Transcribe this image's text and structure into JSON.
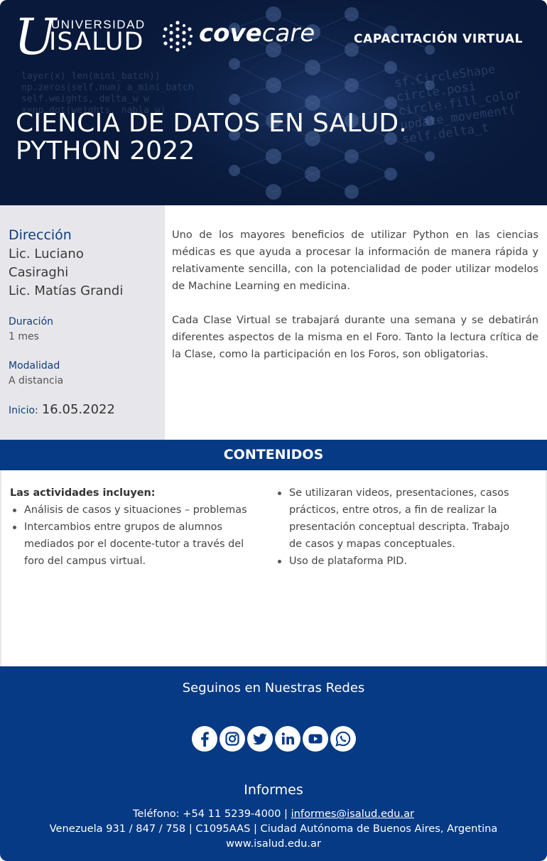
{
  "header": {
    "logo_univ_letter": "U",
    "logo_universidad": "UNIVERSIDAD",
    "logo_isalud": "ISALUD",
    "logo_cove_bold": "cove",
    "logo_cove_light": "care",
    "capacitacion": "CAPACITACIÓN VIRTUAL",
    "title_line1": "CIENCIA DE DATOS EN SALUD.",
    "title_line2": "PYTHON 2022"
  },
  "sidebar": {
    "direccion_label": "Dirección",
    "director_1a": "Lic. Luciano",
    "director_1b": "Casiraghi",
    "director_2": "Lic. Matías Grandi",
    "duracion_label": "Duración",
    "duracion_value": "1 mes",
    "modalidad_label": "Modalidad",
    "modalidad_value": "A distancia",
    "inicio_label": "Inicio:",
    "inicio_value": "16.05.2022"
  },
  "description": {
    "paragraph_1": "Uno de los mayores beneficios de utilizar Python en las ciencias médicas es que ayuda a procesar la información de manera rápida y relativamente sencilla, con la potencialidad de poder utilizar modelos de Machine Learning en medicina.",
    "paragraph_2": "Cada Clase Virtual se trabajará durante una semana y se debatirán diferentes aspectos de la misma en el Foro. Tanto la lectura crítica de la Clase, como la participación en los Foros, son obligatorias."
  },
  "contenidos": {
    "title": "CONTENIDOS",
    "heading": "Las actividades incluyen:",
    "left_items": [
      "Análisis de casos y situaciones – problemas",
      "Intercambios entre grupos de alumnos mediados por el docente-tutor a través del foro del campus virtual."
    ],
    "right_items": [
      "Se utilizaran videos, presentaciones, casos prácticos, entre otros, a fin de realizar la presentación conceptual descripta. Trabajo de casos y mapas conceptuales.",
      "Uso de plataforma PID."
    ]
  },
  "footer": {
    "seguinos": "Seguinos en Nuestras Redes",
    "socials": [
      "facebook-icon",
      "instagram-icon",
      "twitter-icon",
      "linkedin-icon",
      "youtube-icon",
      "whatsapp-icon"
    ],
    "informes_title": "Informes",
    "telefono_prefix": "Teléfono: +54 11 5239-4000 | ",
    "email": "informes@isalud.edu.ar",
    "address": "Venezuela 931 / 847 / 758 | C1095AAS | Ciudad Autónoma de Buenos Aires, Argentina",
    "website": "www.isalud.edu.ar"
  },
  "colors": {
    "brand_blue": "#063a85",
    "heading_blue": "#0e3d7e",
    "sidebar_grey": "#e7e7eb"
  }
}
